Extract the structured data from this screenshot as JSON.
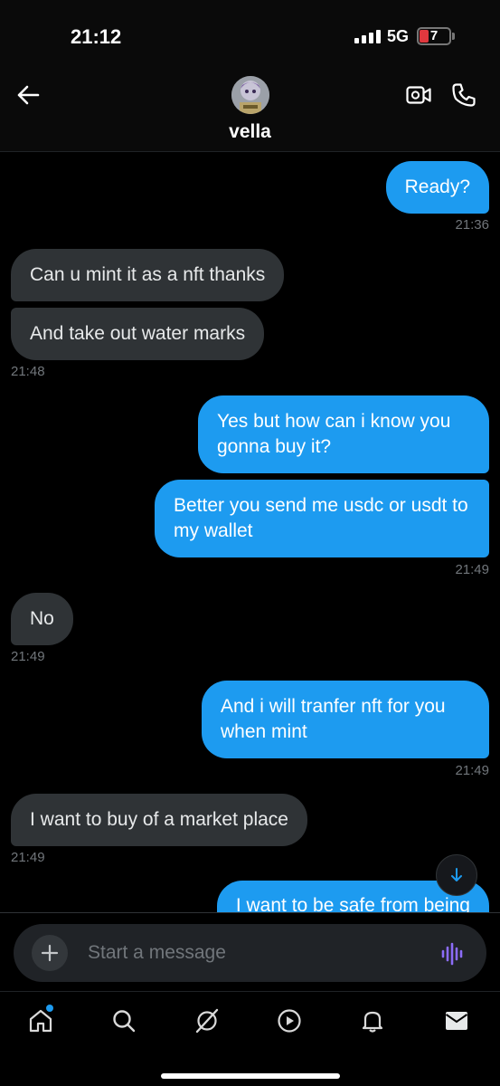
{
  "status": {
    "time": "21:12",
    "network": "5G",
    "battery": "7"
  },
  "header": {
    "contact_name": "vella"
  },
  "messages": [
    {
      "text": "Ready?",
      "time": "21:36"
    },
    {
      "text": "Can u mint it as a nft thanks"
    },
    {
      "text": "And take out water marks",
      "time": "21:48"
    },
    {
      "text": "Yes but how can i know you gonna buy it?"
    },
    {
      "text": "Better you send me usdc or usdt to my wallet",
      "time": "21:49"
    },
    {
      "text": "No",
      "time": "21:49"
    },
    {
      "text": "And i will tranfer nft for you when mint",
      "time": "21:49"
    },
    {
      "text": "I want to buy of a market place",
      "time": "21:49"
    },
    {
      "text": "I want to be safe from being"
    }
  ],
  "composer": {
    "placeholder": "Start a message"
  },
  "icons": {
    "back": "arrow-left-icon",
    "video": "video-icon",
    "call": "phone-icon",
    "plus": "plus-icon",
    "voice": "voice-wave-icon",
    "scroll": "arrow-down-icon",
    "nav": [
      "home-icon",
      "search-icon",
      "grok-icon",
      "play-icon",
      "bell-icon",
      "mail-icon"
    ]
  },
  "colors": {
    "sent_bubble": "#1d9bf0",
    "received_bubble": "#2f3336",
    "accent": "#1d9bf0",
    "voice": "#8b6cf7"
  }
}
